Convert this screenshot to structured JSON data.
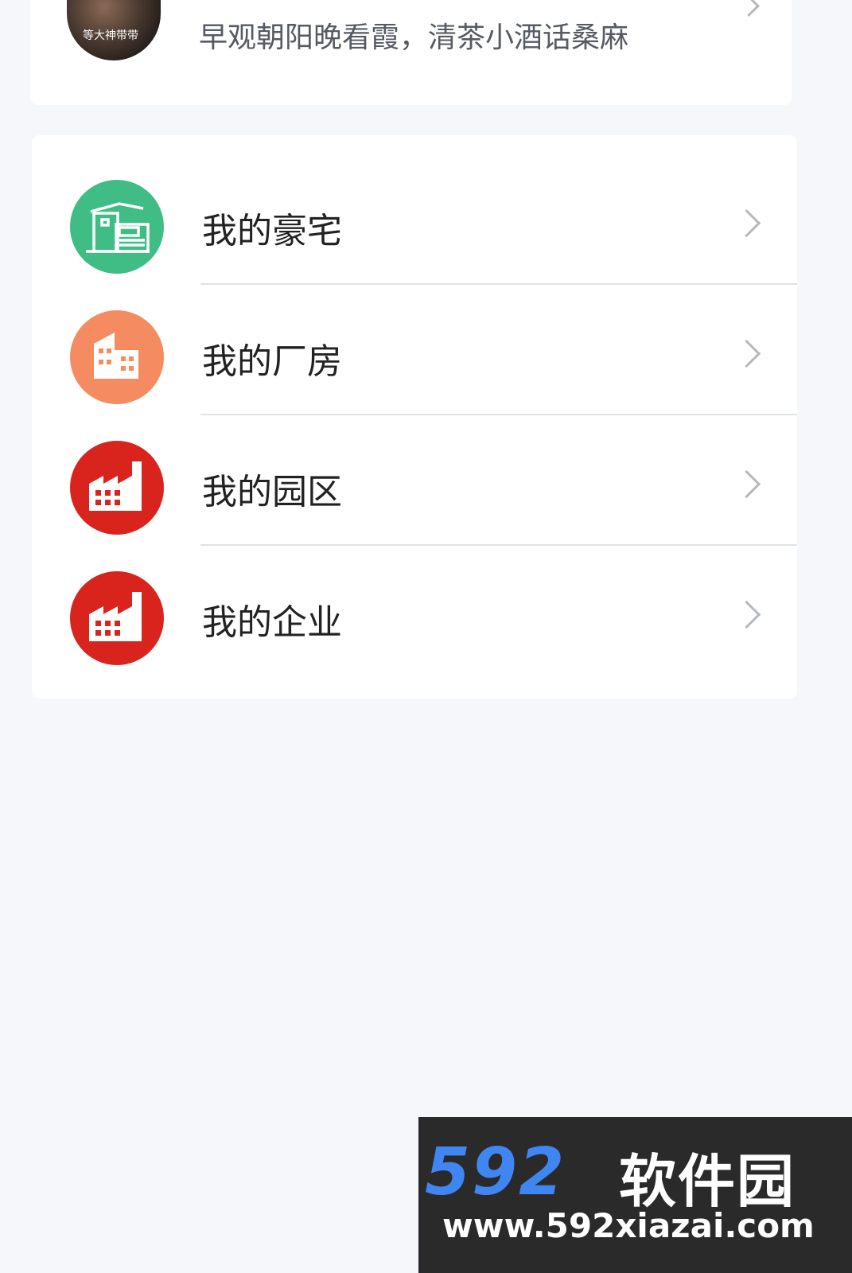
{
  "profile": {
    "avatar_caption": "等大神带带",
    "motto": "早观朝阳晚看霞，清茶小酒话桑麻"
  },
  "menu": {
    "items": [
      {
        "label": "我的豪宅",
        "icon": "villa-icon",
        "color": "#3fbd85"
      },
      {
        "label": "我的厂房",
        "icon": "building-icon",
        "color": "#f58c61"
      },
      {
        "label": "我的园区",
        "icon": "factory-icon",
        "color": "#d8241c"
      },
      {
        "label": "我的企业",
        "icon": "factory-icon",
        "color": "#d8241c"
      }
    ]
  },
  "watermark": {
    "number": "592",
    "name": "软件园",
    "url": "www.592xiazai.com"
  }
}
